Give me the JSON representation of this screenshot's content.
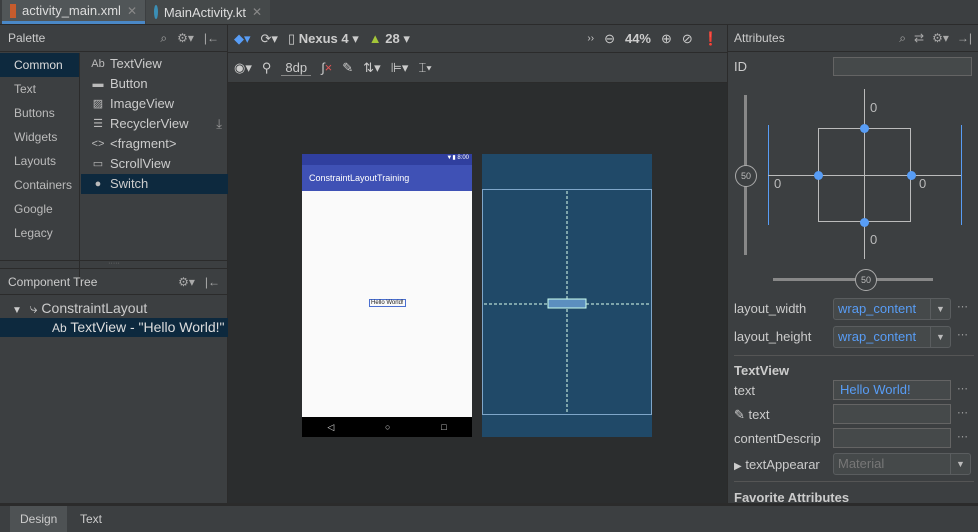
{
  "tabs": [
    {
      "label": "activity_main.xml",
      "close": "✕"
    },
    {
      "label": "MainActivity.kt",
      "close": "✕"
    }
  ],
  "palette": {
    "title": "Palette",
    "categories": [
      "Common",
      "Text",
      "Buttons",
      "Widgets",
      "Layouts",
      "Containers",
      "Google",
      "Legacy"
    ],
    "items": [
      {
        "icon": "Ab",
        "label": "TextView"
      },
      {
        "icon": "▬",
        "label": "Button"
      },
      {
        "icon": "▨",
        "label": "ImageView"
      },
      {
        "icon": "☰",
        "label": "RecyclerView"
      },
      {
        "icon": "<>",
        "label": "<fragment>"
      },
      {
        "icon": "▭",
        "label": "ScrollView"
      },
      {
        "icon": "●",
        "label": "Switch"
      }
    ]
  },
  "tree": {
    "title": "Component Tree",
    "root": "ConstraintLayout",
    "child_icon": "Ab",
    "child": "TextView - \"Hello World!\""
  },
  "toolbar": {
    "device": "Nexus 4",
    "api": "28",
    "zoom": "44%",
    "margin": "8dp"
  },
  "phone": {
    "time": "8:00",
    "app_title": "ConstraintLayoutTraining",
    "hello": "Hello World!"
  },
  "attributes": {
    "title": "Attributes",
    "id_label": "ID",
    "margins": {
      "top": "0",
      "left": "0",
      "right": "0",
      "bottom": "0"
    },
    "bias_v": "50",
    "bias_h": "50",
    "layout_width_label": "layout_width",
    "layout_width": "wrap_content",
    "layout_height_label": "layout_height",
    "layout_height": "wrap_content",
    "section": "TextView",
    "text_label": "text",
    "text_value": "Hello World!",
    "tools_text_label": "text",
    "content_desc_label": "contentDescrip",
    "text_appearance_label": "textAppearar",
    "text_appearance": "Material",
    "favorites": "Favorite Attributes",
    "more": "⋯"
  },
  "bottom_tabs": [
    "Design",
    "Text"
  ]
}
